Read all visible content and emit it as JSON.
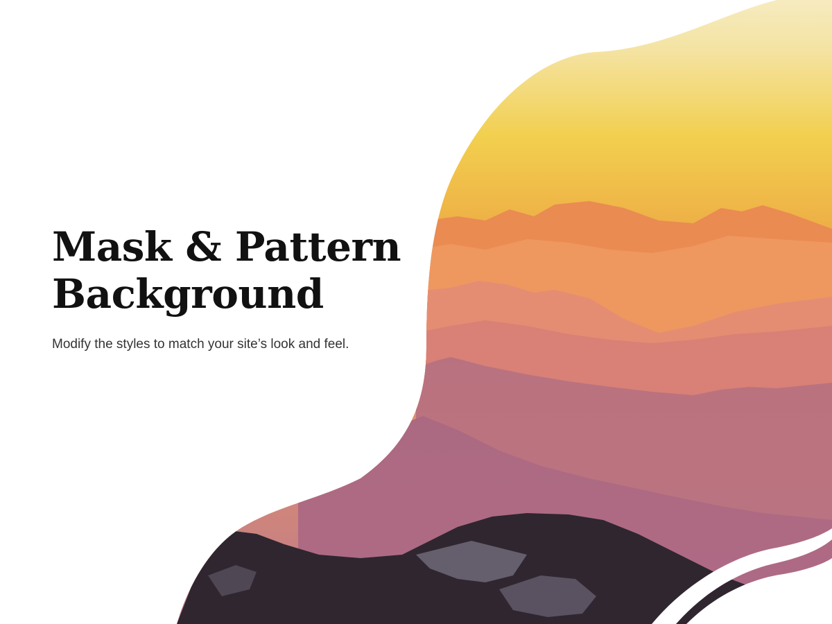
{
  "hero": {
    "title_line1": "Mask & Pattern",
    "title_line2": "Background",
    "subtitle": "Modify the styles to match your site’s look and feel."
  },
  "image": {
    "subject": "mountain-sunset-landscape",
    "colors": {
      "sky_top": "#f6ebc0",
      "sky_mid": "#f2cf4e",
      "sky_low": "#eeb046",
      "ridge_orange": "#e9884f",
      "ridge_peach": "#f0a06e",
      "ridge_rose": "#d98077",
      "ridge_mauve": "#b8717f",
      "ridge_plum": "#9e5a72",
      "foreground_rock": "#2f2630"
    }
  }
}
